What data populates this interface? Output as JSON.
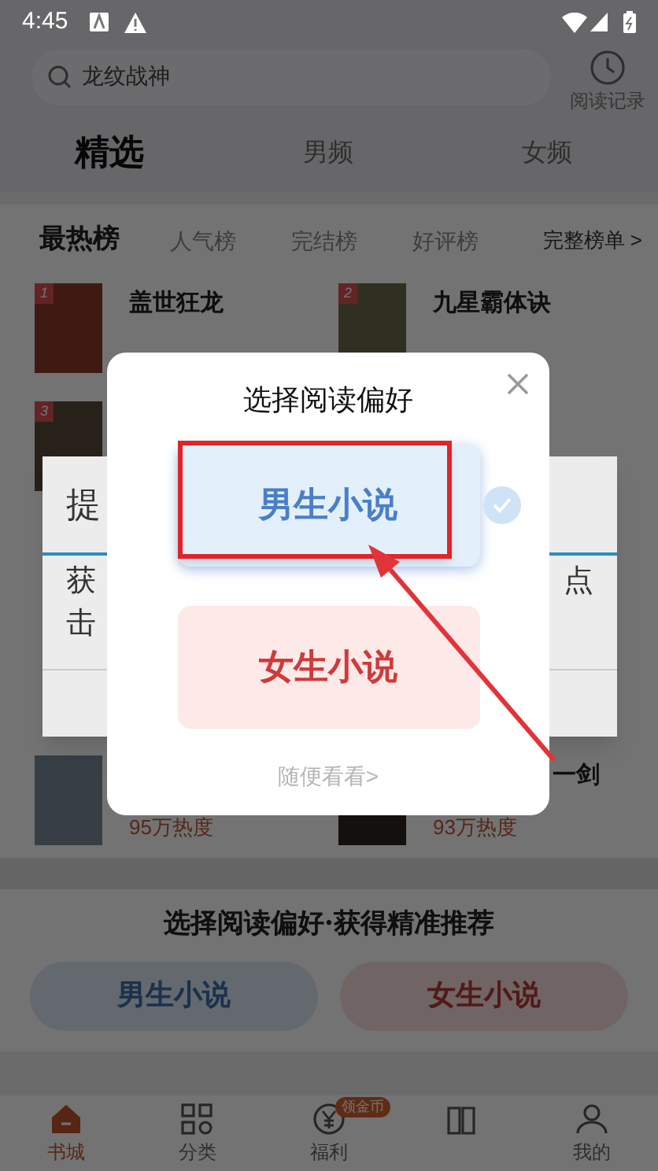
{
  "status_bar": {
    "time": "4:45"
  },
  "search": {
    "value": "龙纹战神"
  },
  "history_button": {
    "label": "阅读记录"
  },
  "channel_tabs": [
    {
      "label": "精选",
      "selected": true
    },
    {
      "label": "男频",
      "selected": false
    },
    {
      "label": "女频",
      "selected": false
    }
  ],
  "ranking": {
    "tabs": [
      {
        "label": "最热榜",
        "selected": true
      },
      {
        "label": "人气榜",
        "selected": false
      },
      {
        "label": "完结榜",
        "selected": false
      },
      {
        "label": "好评榜",
        "selected": false
      }
    ],
    "more": "完整榜单 >",
    "rows": [
      {
        "books": [
          {
            "rank": "1",
            "title": "盖世狂龙"
          },
          {
            "rank": "2",
            "title": "九星霸体诀"
          }
        ]
      },
      {
        "books": [
          {
            "rank": "3"
          }
        ]
      },
      {
        "books": [
          {
            "heat": "95万热度"
          },
          {
            "title": "一剑",
            "heat": "93万热度"
          }
        ]
      }
    ]
  },
  "promo": {
    "title": "选择阅读偏好·获得精准推荐",
    "buttons": [
      {
        "label": "男生小说",
        "kind": "male"
      },
      {
        "label": "女生小说",
        "kind": "female"
      }
    ]
  },
  "bottom_nav": [
    {
      "label": "书城",
      "selected": true
    },
    {
      "label": "分类",
      "selected": false
    },
    {
      "label": "福利",
      "badge": "领金币",
      "selected": false
    },
    {
      "selected": false
    },
    {
      "label": "我的",
      "selected": false
    }
  ],
  "background_dialog": {
    "title": "提",
    "lines": [
      {
        "left": "获",
        "right": "点"
      },
      {
        "left": "击"
      }
    ]
  },
  "modal": {
    "title": "选择阅读偏好",
    "options": [
      {
        "label": "男生小说",
        "kind": "male",
        "selected": true
      },
      {
        "label": "女生小说",
        "kind": "female",
        "selected": false
      }
    ],
    "skip": "随便看看>"
  }
}
